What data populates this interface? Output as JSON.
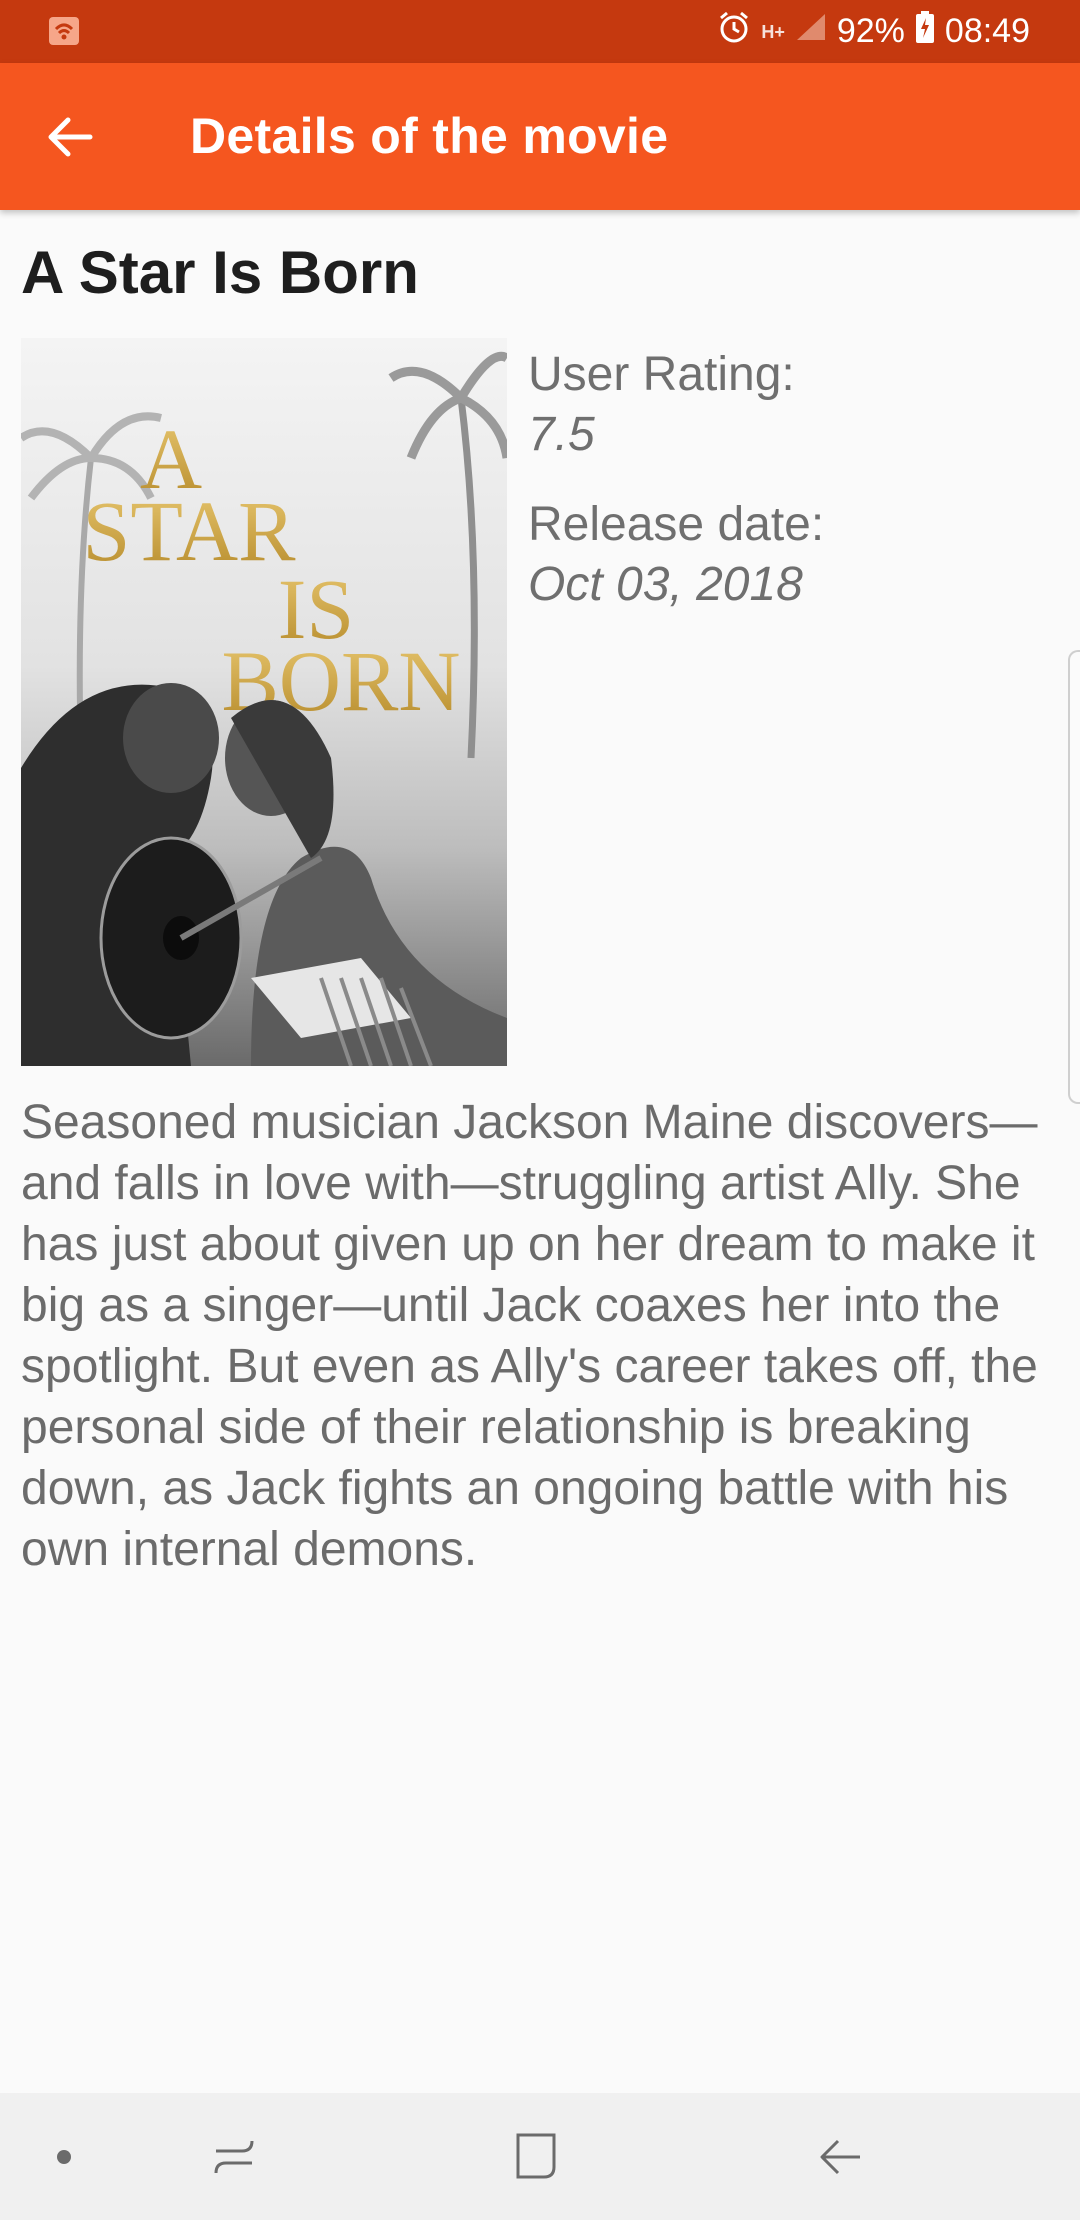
{
  "status_bar": {
    "battery": "92%",
    "time": "08:49",
    "network": "H+"
  },
  "app_bar": {
    "title": "Details of the movie"
  },
  "movie": {
    "title": "A Star Is Born",
    "poster_text": [
      "A",
      "STAR",
      "IS",
      "BORN"
    ],
    "rating_label": "User Rating:",
    "rating_value": "7.5",
    "release_label": "Release date:",
    "release_value": "Oct 03, 2018",
    "overview": "Seasoned musician Jackson Maine discovers—and falls in love with—struggling artist Ally. She has just about given up on her dream to make it big as a singer—until Jack coaxes her into the spotlight. But even as Ally's career takes off, the personal side of their relationship is breaking down, as Jack fights an ongoing battle with his own internal demons."
  },
  "colors": {
    "status_bar": "#c5390f",
    "app_bar": "#f5561f",
    "background": "#fafafa"
  },
  "icons": {
    "back": "arrow-left-icon",
    "wifi": "wifi-icon",
    "alarm": "alarm-icon",
    "signal": "signal-icon",
    "battery": "battery-charging-icon",
    "nav_dot": "dot-icon",
    "recents": "recents-icon",
    "home": "home-icon",
    "nav_back": "nav-back-icon"
  }
}
